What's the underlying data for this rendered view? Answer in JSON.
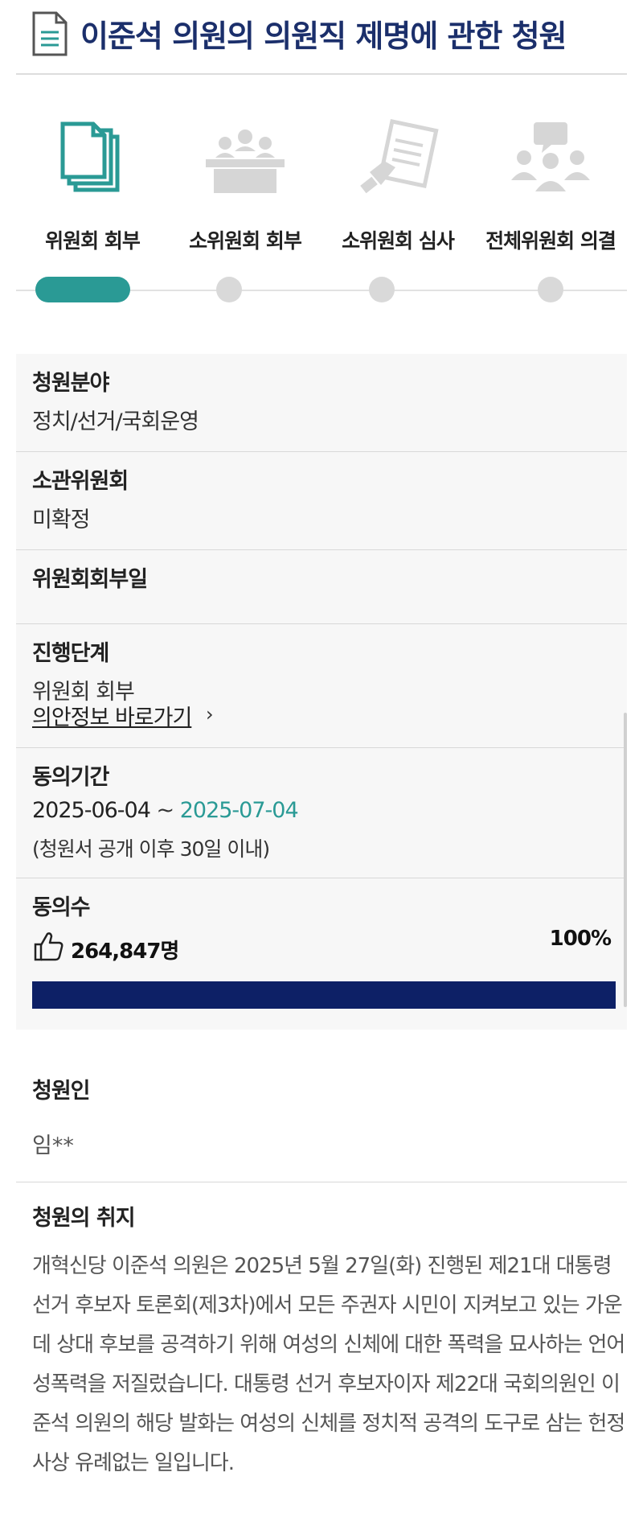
{
  "header": {
    "title": "이준석 의원의 의원직 제명에 관한 청원",
    "icon": "document-icon"
  },
  "stages": [
    {
      "label": "위원회 회부",
      "icon": "documents-icon",
      "active": true
    },
    {
      "label": "소위원회 회부",
      "icon": "committee-meeting-icon",
      "active": false
    },
    {
      "label": "소위원회 심사",
      "icon": "review-hand-icon",
      "active": false
    },
    {
      "label": "전체위원회 의결",
      "icon": "discussion-group-icon",
      "active": false
    }
  ],
  "info": {
    "field": {
      "label": "청원분야",
      "value": "정치/선거/국회운영"
    },
    "committee": {
      "label": "소관위원회",
      "value": "미확정"
    },
    "referral_date": {
      "label": "위원회회부일",
      "value": ""
    },
    "progress": {
      "label": "진행단계",
      "value": "위원회 회부",
      "link": "의안정보 바로가기",
      "chevron": "›"
    },
    "period": {
      "label": "동의기간",
      "start": "2025-06-04",
      "separator": " ~ ",
      "end": "2025-07-04",
      "note": "(청원서 공개 이후 30일 이내)"
    },
    "agree": {
      "label": "동의수",
      "count": "264,847명",
      "percent_label": "100%",
      "progress": 1.0
    }
  },
  "petitioner": {
    "label": "청원인",
    "value": "임**"
  },
  "purpose": {
    "label": "청원의 취지",
    "text": "개혁신당 이준석 의원은 2025년 5월 27일(화) 진행된 제21대 대통령 선거 후보자 토론회(제3차)에서 모든 주권자 시민이 지켜보고 있는 가운데 상대 후보를 공격하기 위해 여성의 신체에 대한 폭력을 묘사하는 언어 성폭력을 저질렀습니다. 대통령 선거 후보자이자 제22대 국회의원인 이준석 의원의 해당 발화는 여성의 신체를 정치적 공격의 도구로 삼는 헌정사상 유례없는 일입니다."
  },
  "colors": {
    "title": "#1b2f6b",
    "accent": "#2a9a95",
    "bar": "#0d2066"
  }
}
